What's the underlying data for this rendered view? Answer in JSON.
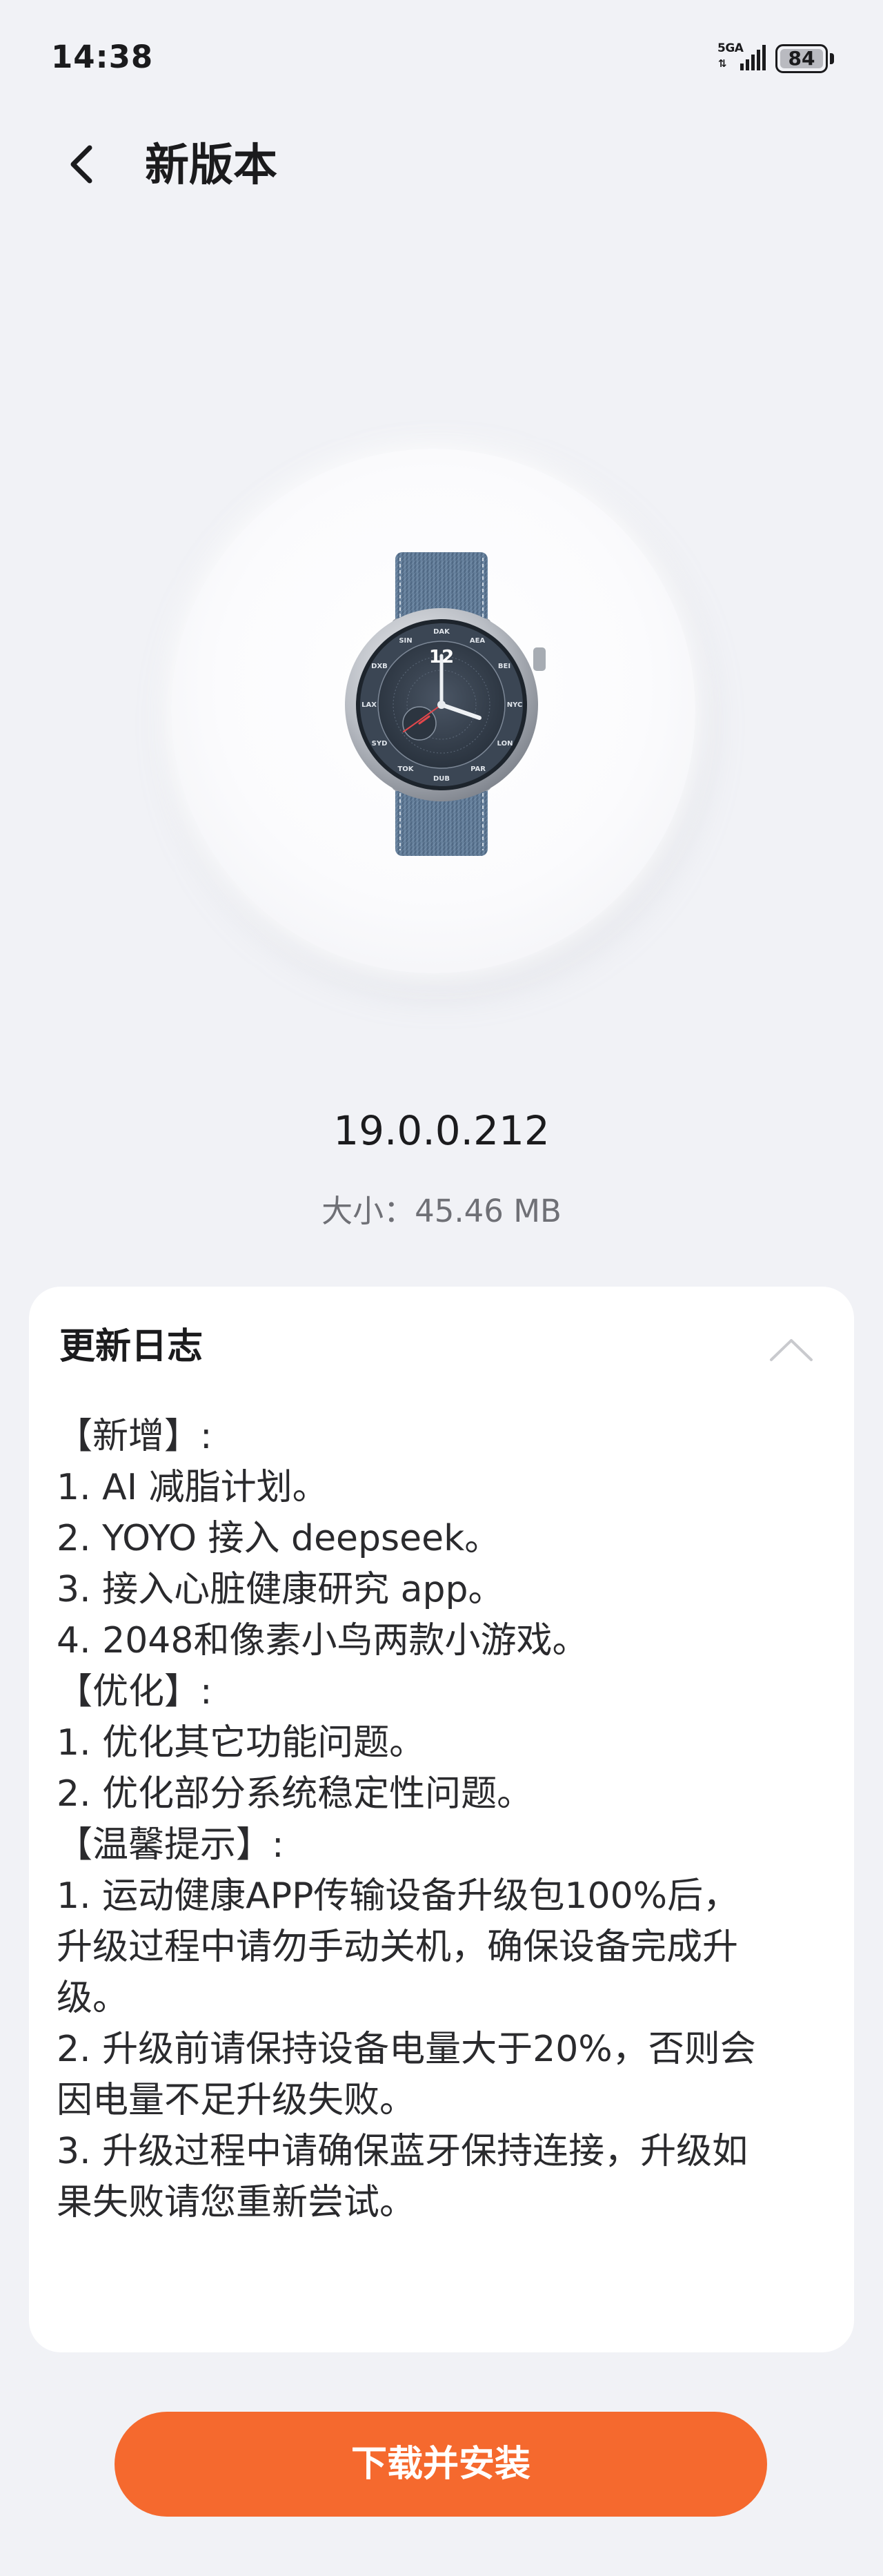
{
  "status_bar": {
    "time": "14:38",
    "network": "5GA",
    "battery": "84"
  },
  "header": {
    "title": "新版本",
    "back_icon": "chevron-left-icon"
  },
  "device": {
    "image": "smartwatch-image",
    "watch_face": {
      "hour": "12",
      "cities": [
        "DAK",
        "AEA",
        "BEI",
        "NYC",
        "LON",
        "PAR",
        "DUB",
        "TOK",
        "SYD",
        "LAX",
        "DXB",
        "SIN"
      ]
    }
  },
  "version": {
    "number": "19.0.0.212",
    "size_label": "大小：",
    "size_value": "45.46 MB"
  },
  "changelog": {
    "title": "更新日志",
    "collapse_icon": "chevron-up-icon",
    "lines": [
      "【新增】:",
      "1. AI 减脂计划。",
      "2. YOYO 接入 deepseek。",
      "3. 接入心脏健康研究 app。",
      "4. 2048和像素小鸟两款小游戏。",
      "【优化】:",
      "1. 优化其它功能问题。",
      "2. 优化部分系统稳定性问题。",
      "【温馨提示】:",
      "1. 运动健康APP传输设备升级包100%后，",
      "升级过程中请勿手动关机，确保设备完成升",
      "级。",
      "2. 升级前请保持设备电量大于20%，否则会",
      "因电量不足升级失败。",
      "3. 升级过程中请确保蓝牙保持连接，升级如",
      "果失败请您重新尝试。"
    ]
  },
  "actions": {
    "install_label": "下载并安装"
  },
  "colors": {
    "background": "#f1f2f6",
    "accent": "#f5692e",
    "card": "#ffffff"
  }
}
